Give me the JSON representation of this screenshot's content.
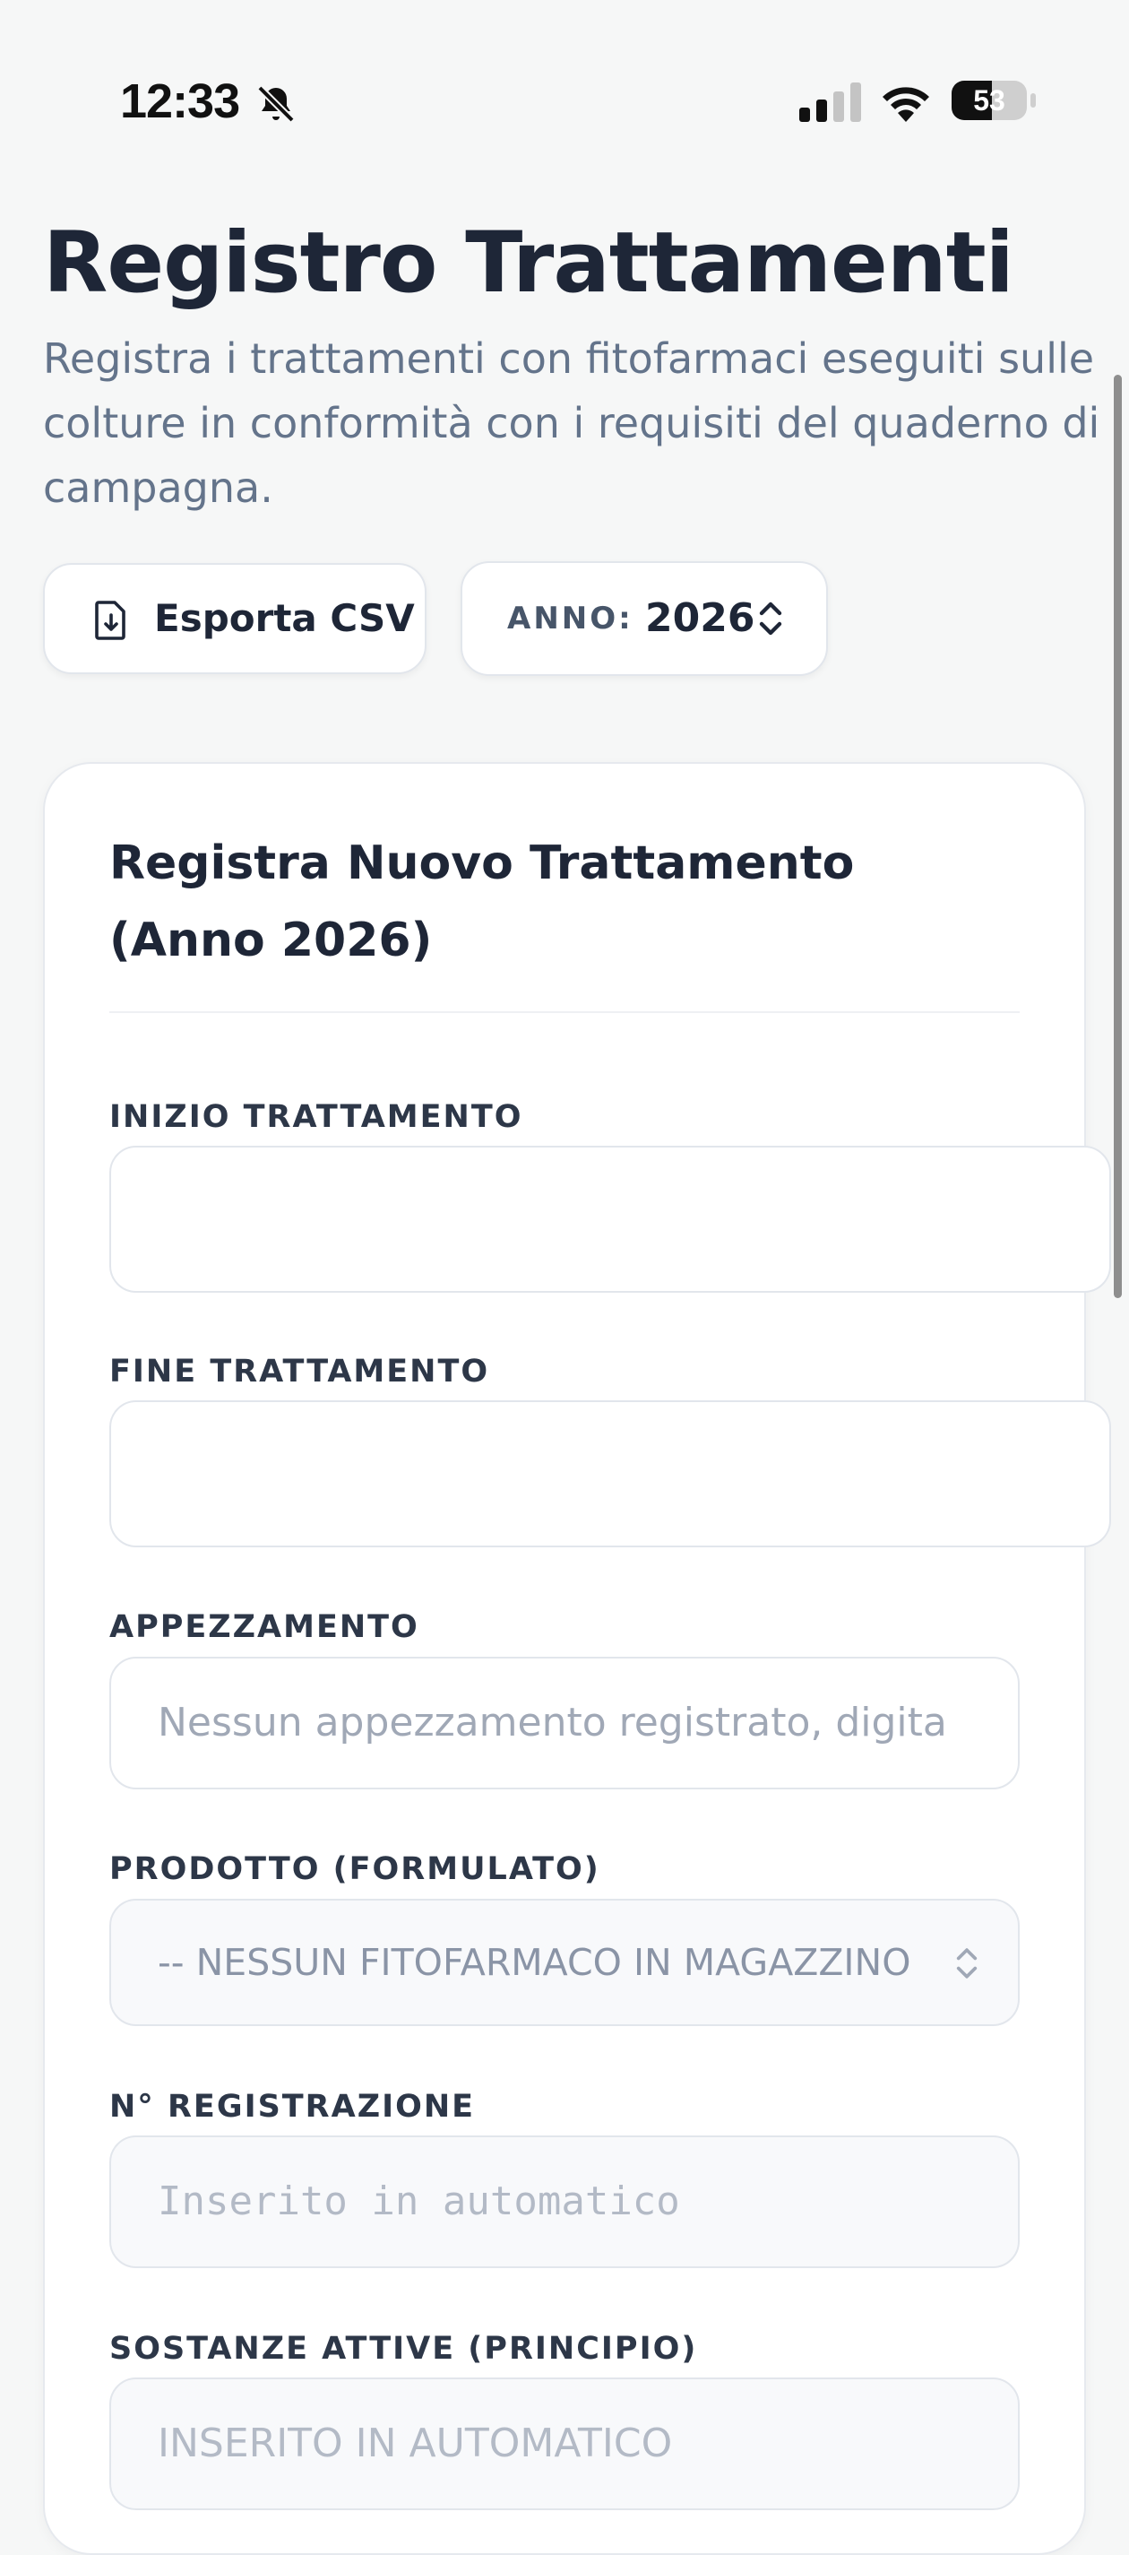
{
  "status": {
    "time": "12:33",
    "battery": "53",
    "battery_level": 0.53,
    "icons": [
      "bell-off-icon",
      "cellular-signal-icon",
      "wifi-icon",
      "battery-icon"
    ]
  },
  "header": {
    "title": "Registro Trattamenti",
    "subtitle": "Registra i trattamenti con fitofarmaci eseguiti sulle colture in conformità con i requisiti del quaderno di campagna."
  },
  "toolbar": {
    "export_label": "Esporta CSV",
    "export_icon": "file-download-icon",
    "year_prefix": "ANNO:",
    "year_value": "2026",
    "year_icon": "chevron-updown-icon"
  },
  "form": {
    "title": "Registra Nuovo Trattamento (Anno 2026)",
    "fields": {
      "start": {
        "label": "INIZIO TRATTAMENTO",
        "value": ""
      },
      "end": {
        "label": "FINE TRATTAMENTO",
        "value": ""
      },
      "plot": {
        "label": "APPEZZAMENTO",
        "placeholder": "Nessun appezzamento registrato, digita"
      },
      "product": {
        "label": "PRODOTTO (FORMULATO)",
        "selected": "-- NESSUN FITOFARMACO IN MAGAZZINO"
      },
      "registration": {
        "label": "N° REGISTRAZIONE",
        "placeholder": "Inserito in automatico"
      },
      "substances": {
        "label": "SOSTANZE ATTIVE (PRINCIPIO)",
        "placeholder": "INSERITO IN AUTOMATICO"
      }
    }
  },
  "colors": {
    "background": "#f6f7f7",
    "title": "#1e2637",
    "muted": "#64748b",
    "placeholder": "#a0a8b6",
    "border": "#e2e6ec"
  }
}
